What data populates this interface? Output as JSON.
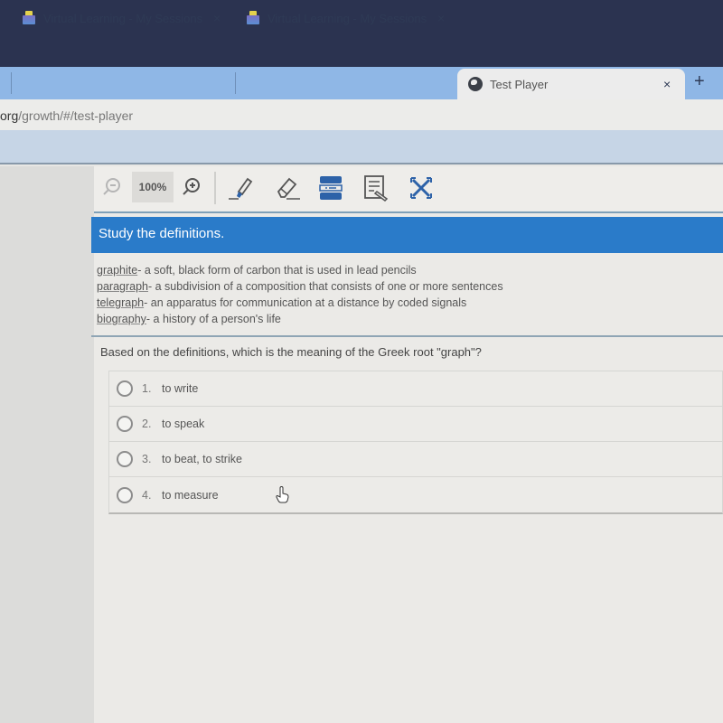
{
  "browser": {
    "tabs": [
      {
        "label": "Virtual Learning - My Sessions",
        "icon": "app-favicon",
        "close": "×",
        "active": false
      },
      {
        "label": "Virtual Learning - My Sessions",
        "icon": "app-favicon",
        "close": "×",
        "active": false
      },
      {
        "label": "Test Player",
        "icon": "globe-icon",
        "close": "×",
        "active": true
      }
    ],
    "new_tab": "+",
    "url_domain": "org",
    "url_path": "/growth/#/test-player"
  },
  "toolbar": {
    "zoom_level": "100%",
    "tools": [
      "zoom-out",
      "zoom-in",
      "highlighter",
      "eraser",
      "line-reader",
      "notepad",
      "answer-eliminator"
    ]
  },
  "passage": {
    "title": "Study the definitions.",
    "definitions": [
      {
        "term": "graphite",
        "definition": "- a soft, black form of carbon that is used in lead pencils"
      },
      {
        "term": "paragraph",
        "definition": "- a subdivision of a composition that consists of one or more sentences"
      },
      {
        "term": "telegraph",
        "definition": "- an apparatus for communication at a distance by coded signals"
      },
      {
        "term": "biography",
        "definition": "- a history of a person's life"
      }
    ]
  },
  "question": {
    "prompt": "Based on the definitions, which is the meaning of the Greek root \"graph\"?",
    "options": [
      {
        "number": "1.",
        "text": "to write",
        "selected": false
      },
      {
        "number": "2.",
        "text": "to speak",
        "selected": false
      },
      {
        "number": "3.",
        "text": "to beat, to strike",
        "selected": false
      },
      {
        "number": "4.",
        "text": "to measure",
        "selected": false
      }
    ]
  },
  "colors": {
    "banner": "#2a7bc9",
    "tool_blue": "#2d62a8"
  }
}
